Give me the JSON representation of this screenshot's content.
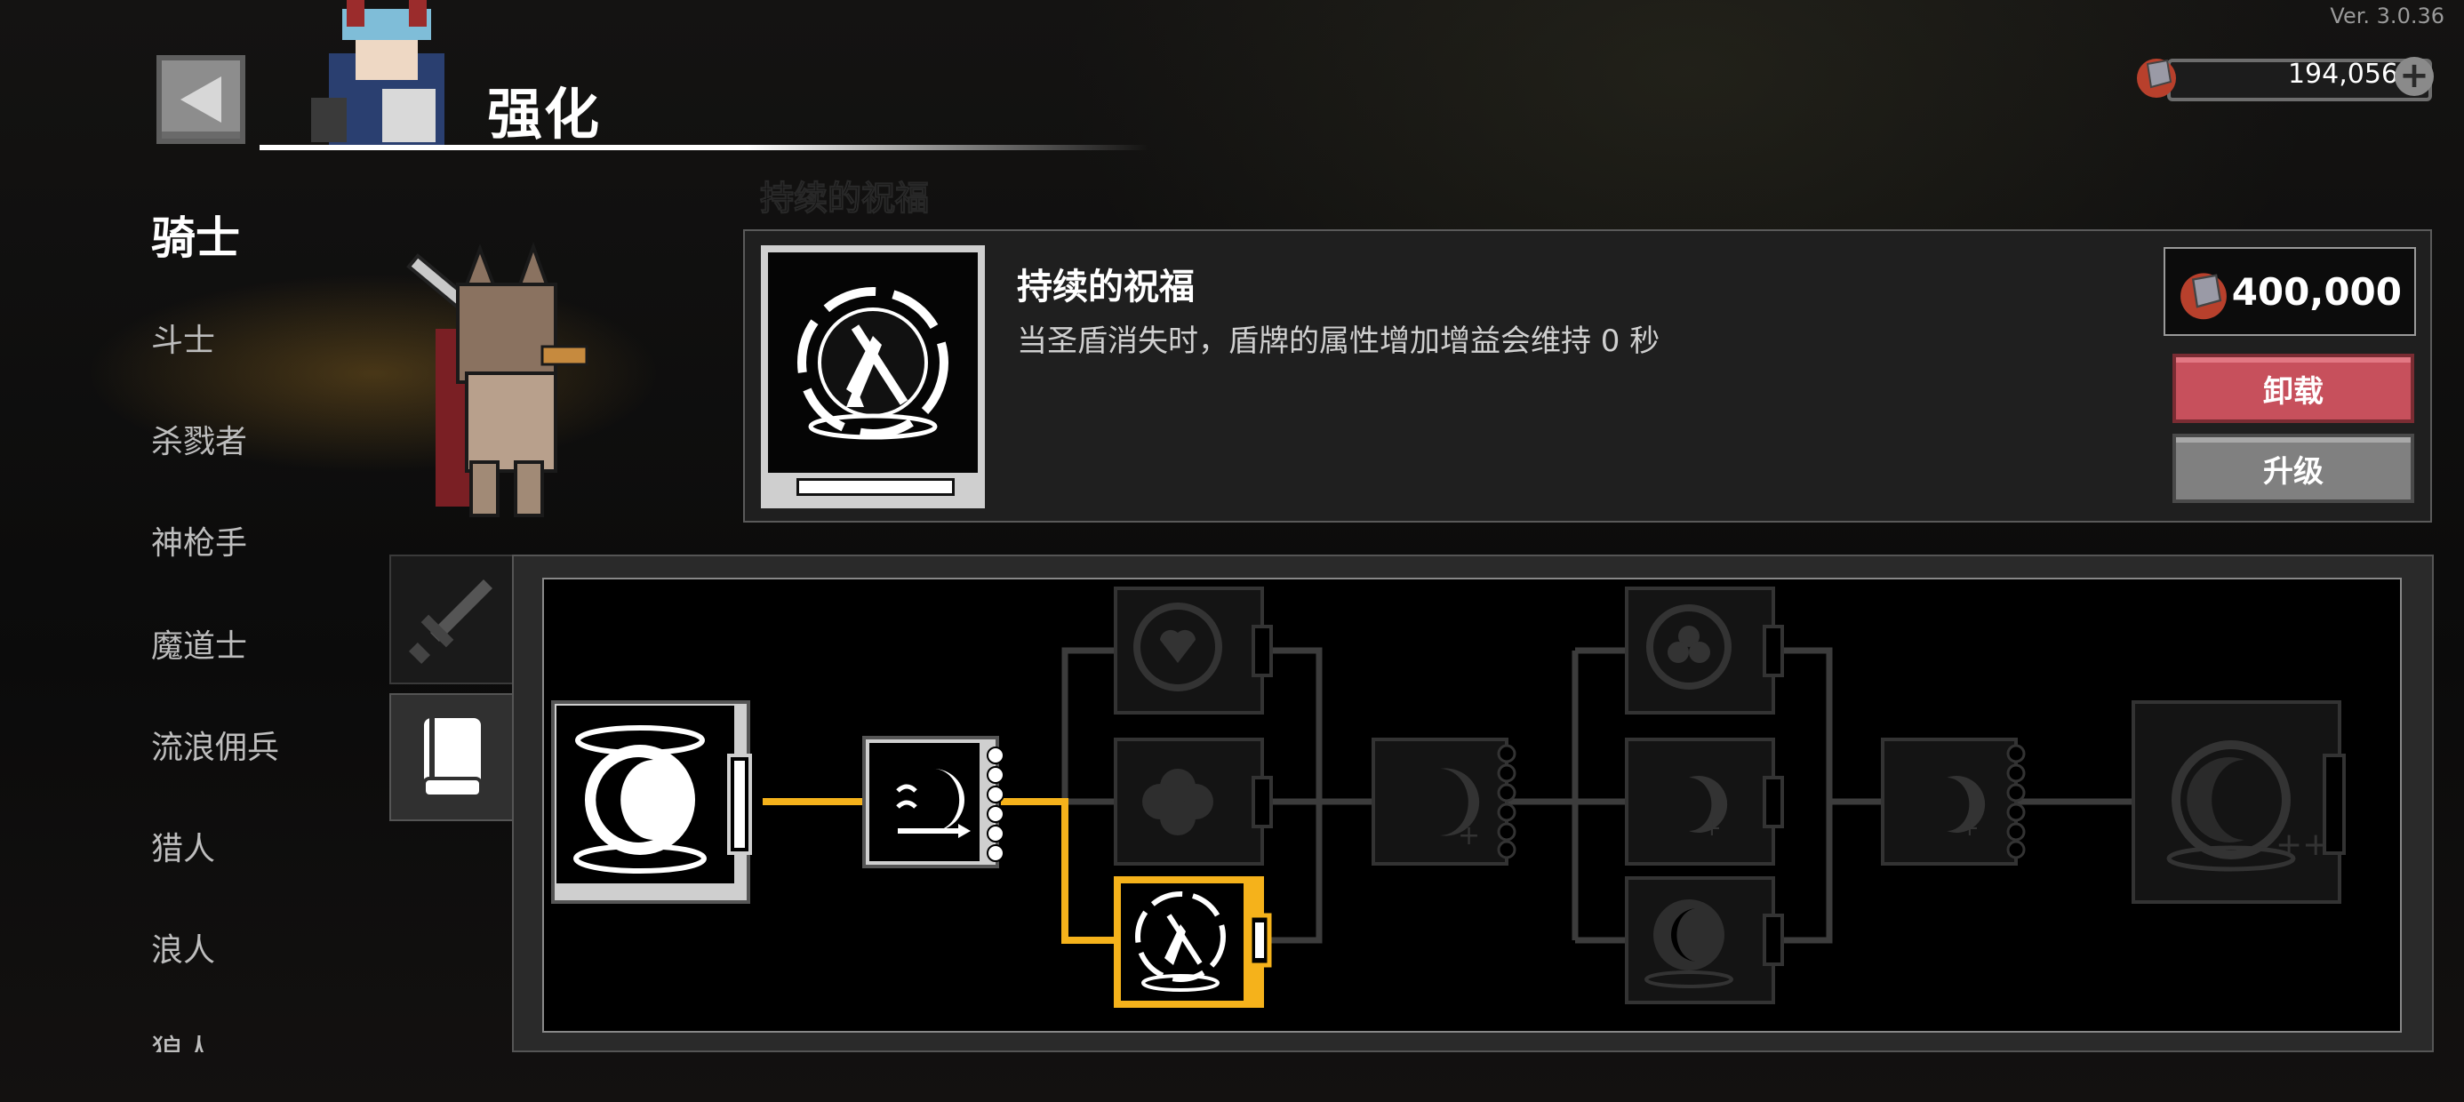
{
  "version": "Ver. 3.0.36",
  "header": {
    "title": "强化",
    "currency_amount": "194,056"
  },
  "classes": [
    "骑士",
    "斗士",
    "杀戮者",
    "神枪手",
    "魔道士",
    "流浪佣兵",
    "猎人",
    "浪人",
    "狼人"
  ],
  "active_class": "骑士",
  "section_title": "持续的祝福",
  "skill": {
    "name": "持续的祝福",
    "description": "当圣盾消失时，盾牌的属性增加增益会维持 0 秒",
    "cost": "400,000",
    "unequip_label": "卸载",
    "upgrade_label": "升级"
  },
  "tabs": [
    {
      "name": "weapon",
      "icon": "sword-icon",
      "active": false
    },
    {
      "name": "skill",
      "icon": "book-icon",
      "active": true
    }
  ],
  "tree": {
    "selected_node": "persistent-blessing",
    "highlight_color": "#f5b21b",
    "nodes": [
      {
        "id": "root-holy-shield",
        "icon": "moon-orb-icon",
        "state": "unlocked"
      },
      {
        "id": "moon-dash",
        "icon": "moon-arrow-icon",
        "state": "unlocked"
      },
      {
        "id": "shield-heart",
        "icon": "shield-heart-icon",
        "state": "locked"
      },
      {
        "id": "flower-orb",
        "icon": "flower-orb-icon",
        "state": "locked"
      },
      {
        "id": "persistent-blessing",
        "icon": "sword-shield-blessing-icon",
        "state": "equipped"
      },
      {
        "id": "moon-plus-1",
        "icon": "moon-plus-icon",
        "state": "locked"
      },
      {
        "id": "clover-orb",
        "icon": "clover-orb-icon",
        "state": "locked"
      },
      {
        "id": "moon-plus-2",
        "icon": "moon-plus-icon",
        "state": "locked"
      },
      {
        "id": "moon-orb-small",
        "icon": "moon-orb-icon",
        "state": "locked"
      },
      {
        "id": "moon-plus-3",
        "icon": "moon-plus-icon",
        "state": "locked"
      },
      {
        "id": "ultimate-orb",
        "icon": "orb-plus-plus-icon",
        "state": "locked"
      }
    ]
  }
}
